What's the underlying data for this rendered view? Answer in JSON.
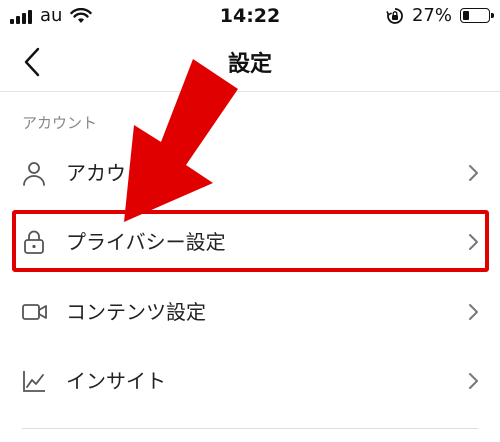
{
  "status_bar": {
    "carrier": "au",
    "time": "14:22",
    "battery_percent_label": "27%",
    "battery_level": 0.27,
    "icons": [
      "signal-bars-icon",
      "wifi-icon",
      "orientation-lock-icon",
      "battery-icon"
    ]
  },
  "nav": {
    "title": "設定",
    "back_icon": "chevron-left-icon"
  },
  "section": {
    "header": "アカウント",
    "items": [
      {
        "label": "アカウント",
        "icon": "person-icon"
      },
      {
        "label": "プライバシー設定",
        "icon": "lock-icon",
        "highlighted": true
      },
      {
        "label": "コンテンツ設定",
        "icon": "video-camera-icon"
      },
      {
        "label": "インサイト",
        "icon": "chart-icon"
      }
    ]
  },
  "annotation": {
    "highlight_color": "#e10000",
    "target": "プライバシー設定"
  }
}
